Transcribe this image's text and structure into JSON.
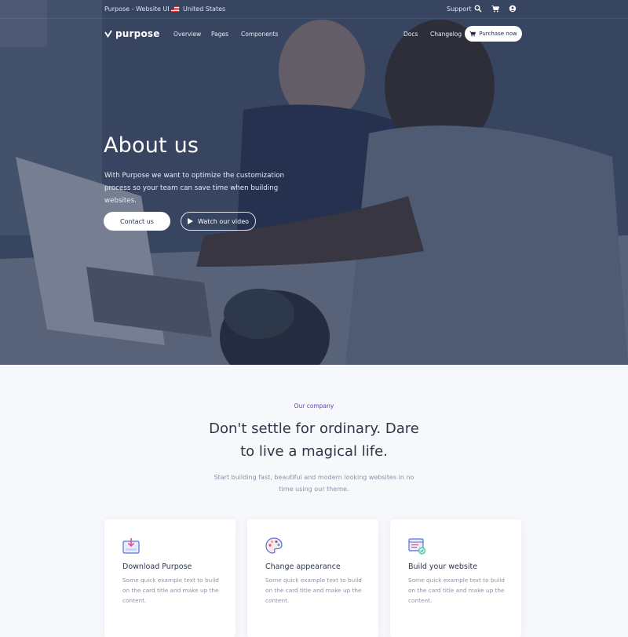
{
  "topbar": {
    "kit_label": "Purpose - Website UI Kit",
    "country": "United States",
    "support": "Support",
    "icons": [
      "search-icon",
      "cart-icon",
      "user-icon"
    ]
  },
  "nav": {
    "logo_text": "purpose",
    "links": [
      "Overview",
      "Pages",
      "Components"
    ],
    "right_links": [
      "Docs",
      "Changelog"
    ],
    "purchase": "Purchase now"
  },
  "hero": {
    "title": "About us",
    "description": "With Purpose we want to optimize the customization process so your team can save time when building websites.",
    "contact_button": "Contact us",
    "video_button": "Watch our video"
  },
  "company": {
    "eyebrow": "Our company",
    "heading_line1": "Don't settle for ordinary. Dare",
    "heading_line2": "to live a magical life.",
    "subtext": "Start building fast, beautiful and modern looking websites in no time using our theme."
  },
  "cards": [
    {
      "title": "Download Purpose",
      "text": "Some quick example text to build on the card title and make up the content.",
      "icon": "download-box-icon"
    },
    {
      "title": "Change appearance",
      "text": "Some quick example text to build on the card title and make up the content.",
      "icon": "palette-icon"
    },
    {
      "title": "Build your website",
      "text": "Some quick example text to build on the card title and make up the content.",
      "icon": "browser-check-icon"
    }
  ],
  "colors": {
    "accent": "#5a3fbf",
    "hero_overlay": "#2b3a5c",
    "section_bg": "#f6f8fc"
  }
}
